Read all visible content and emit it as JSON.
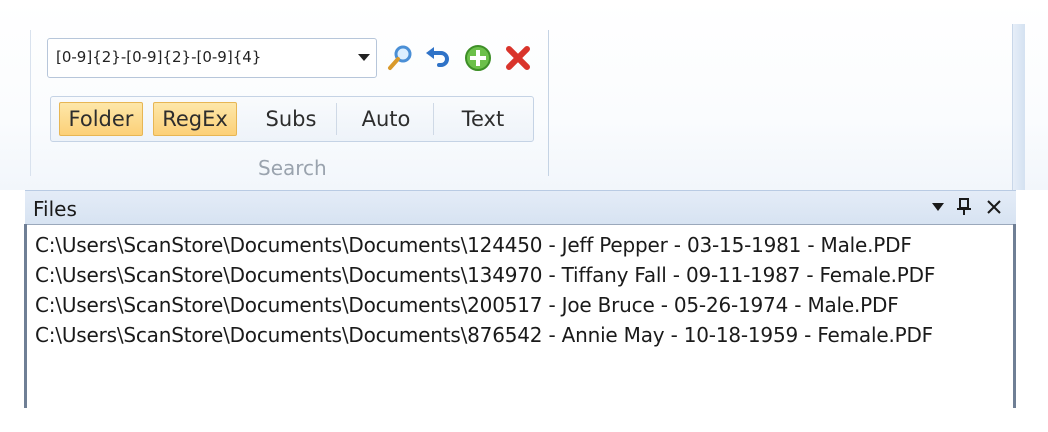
{
  "search": {
    "pattern": "[0-9]{2}-[0-9]{2}-[0-9]{4}",
    "group_label": "Search",
    "tools": [
      "search-icon",
      "undo-icon",
      "add-icon",
      "delete-icon"
    ],
    "toggles": [
      {
        "label": "Folder",
        "active": true
      },
      {
        "label": "RegEx",
        "active": true
      },
      {
        "label": "Subs",
        "active": false
      },
      {
        "label": "Auto",
        "active": false
      },
      {
        "label": "Text",
        "active": false
      }
    ]
  },
  "files_panel": {
    "title": "Files",
    "header_icons": [
      "dropdown-icon",
      "pin-icon",
      "close-icon"
    ],
    "files": [
      "C:\\Users\\ScanStore\\Documents\\Documents\\124450 - Jeff Pepper - 03-15-1981 - Male.PDF",
      "C:\\Users\\ScanStore\\Documents\\Documents\\134970 - Tiffany Fall - 09-11-1987 - Female.PDF",
      "C:\\Users\\ScanStore\\Documents\\Documents\\200517 - Joe Bruce - 05-26-1974 - Male.PDF",
      "C:\\Users\\ScanStore\\Documents\\Documents\\876542 - Annie May - 10-18-1959 - Female.PDF"
    ]
  },
  "colors": {
    "toggle_active": "#fcd078",
    "panel_header": "#dce6f4",
    "accent_blue": "#3a7bd5"
  }
}
